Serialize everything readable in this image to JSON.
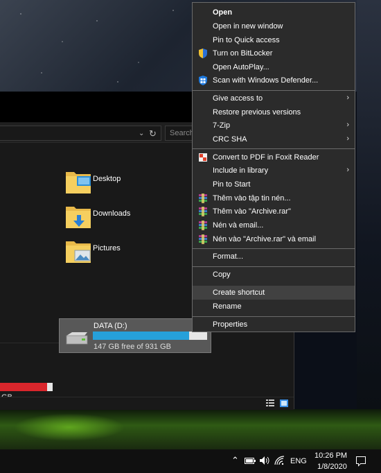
{
  "explorer": {
    "search_placeholder": "Search",
    "folders": [
      {
        "label": "Desktop",
        "icon": "desktop-folder-icon"
      },
      {
        "label": "Downloads",
        "icon": "downloads-folder-icon"
      },
      {
        "label": "Pictures",
        "icon": "pictures-folder-icon"
      }
    ],
    "drive_c": {
      "text": "GB",
      "used_fraction": 0.9
    },
    "drive_d": {
      "label": "DATA (D:)",
      "free_text": "147 GB free of 931 GB",
      "used_fraction": 0.84
    }
  },
  "context_menu": {
    "items": [
      {
        "label": "Open",
        "bold": true
      },
      {
        "label": "Open in new window"
      },
      {
        "label": "Pin to Quick access"
      },
      {
        "label": "Turn on BitLocker",
        "icon": "shield-icon"
      },
      {
        "label": "Open AutoPlay..."
      },
      {
        "label": "Scan with Windows Defender...",
        "icon": "windows-defender-icon"
      },
      {
        "label": "Give access to",
        "submenu": true
      },
      {
        "label": "Restore previous versions"
      },
      {
        "label": "7-Zip",
        "submenu": true
      },
      {
        "label": "CRC SHA",
        "submenu": true
      },
      {
        "label": "Convert to PDF in Foxit Reader",
        "icon": "foxit-pdf-icon"
      },
      {
        "label": "Include in library",
        "submenu": true
      },
      {
        "label": "Pin to Start"
      },
      {
        "label": "Thêm vào tập tin nén...",
        "icon": "winrar-icon"
      },
      {
        "label": "Thêm vào \"Archive.rar\"",
        "icon": "winrar-icon"
      },
      {
        "label": "Nén và email...",
        "icon": "winrar-icon"
      },
      {
        "label": "Nén vào \"Archive.rar\" và email",
        "icon": "winrar-icon"
      },
      {
        "label": "Format..."
      },
      {
        "label": "Copy"
      },
      {
        "label": "Create shortcut",
        "highlighted": true
      },
      {
        "label": "Rename"
      },
      {
        "label": "Properties"
      }
    ]
  },
  "taskbar": {
    "language": "ENG",
    "time": "10:26 PM",
    "date": "1/8/2020"
  },
  "colors": {
    "menu_bg": "#2b2b2b",
    "menu_highlight": "#414141",
    "drive_c_fill": "#d9262c",
    "drive_d_fill": "#26a0da"
  }
}
